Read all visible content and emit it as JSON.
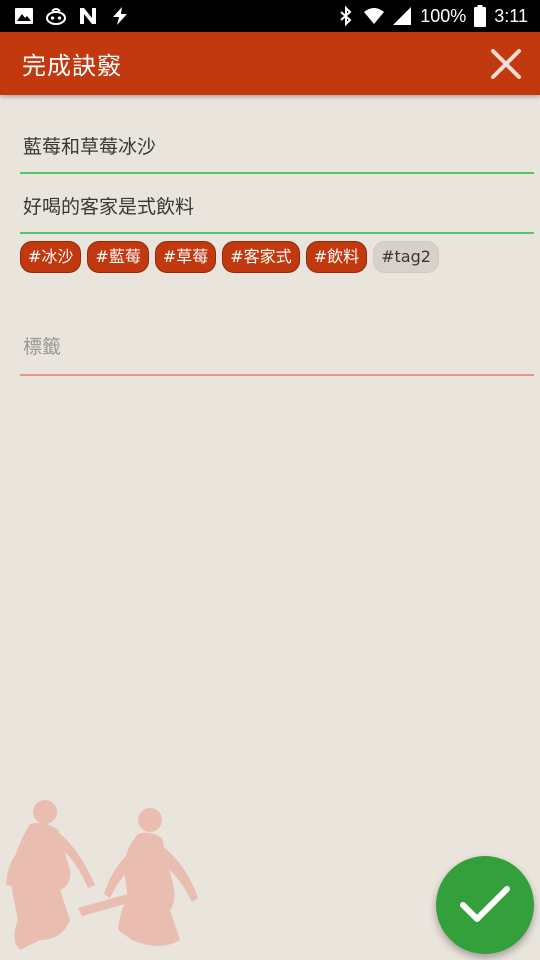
{
  "status_bar": {
    "battery": "100%",
    "time": "3:11",
    "icons_left": [
      "image-icon",
      "robot-icon",
      "n-logo-icon",
      "flash-icon"
    ],
    "icons_right": [
      "bluetooth-icon",
      "wifi-icon",
      "signal-icon",
      "battery-icon"
    ]
  },
  "app_bar": {
    "title": "完成訣竅",
    "close_icon": "close-icon",
    "color": "#c2380f"
  },
  "form": {
    "name_value": "藍莓和草莓冰沙",
    "description_value": "好喝的客家是式飲料",
    "tags": [
      {
        "label": "#冰沙",
        "active": true
      },
      {
        "label": "#藍莓",
        "active": true
      },
      {
        "label": "#草莓",
        "active": true
      },
      {
        "label": "#客家式",
        "active": true
      },
      {
        "label": "#飲料",
        "active": true
      },
      {
        "label": "#tag2",
        "active": false
      }
    ],
    "tag_input_placeholder": "標籤"
  },
  "fab": {
    "icon": "check-icon",
    "color": "#34a03b"
  }
}
